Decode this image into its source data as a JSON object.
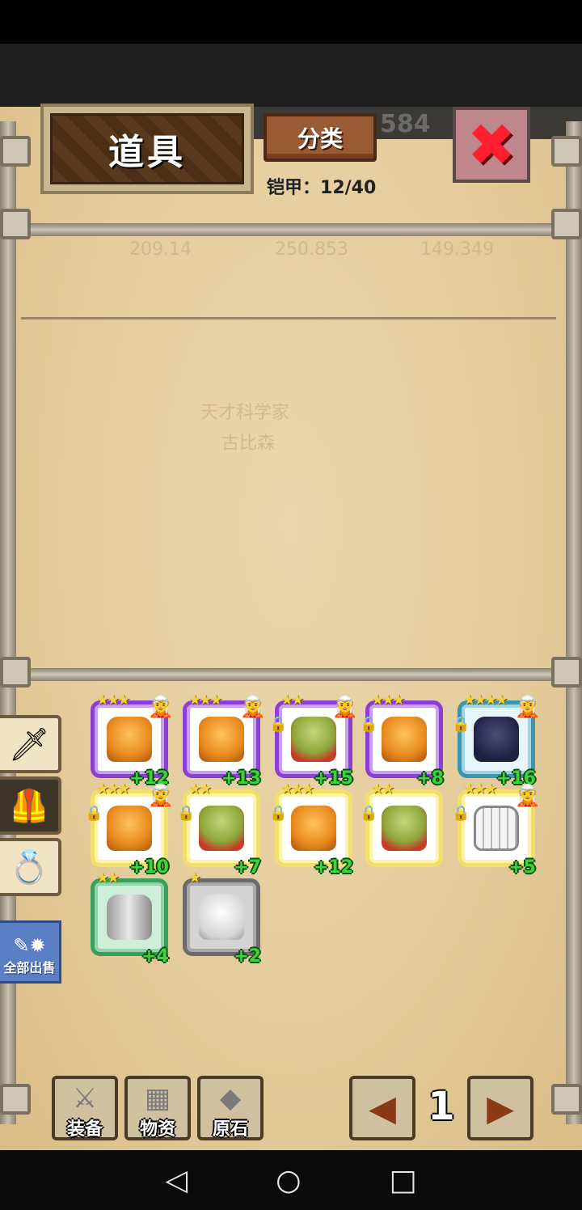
{
  "header": {
    "title": "道具",
    "category_label": "分类",
    "armor_label": "铠甲：",
    "armor_count": "12/40",
    "hud_number": "584"
  },
  "background_ghost_text": [
    "209.14",
    "250.853",
    "149.349",
    "天才科学家",
    "古比森"
  ],
  "side_tabs": [
    {
      "name": "weapon-tab",
      "icon": "sword-icon"
    },
    {
      "name": "armor-tab",
      "icon": "armor-icon",
      "active": true
    },
    {
      "name": "accessory-tab",
      "icon": "ring-icon"
    }
  ],
  "sell_all_label": "全部出售",
  "items": [
    {
      "rarity": "purple",
      "armor": "orange",
      "stars": "★★★",
      "level": "+12",
      "locked": false,
      "hero": true
    },
    {
      "rarity": "purple",
      "armor": "orange",
      "stars": "★★★",
      "level": "+13",
      "locked": false,
      "hero": true
    },
    {
      "rarity": "purple",
      "armor": "olive",
      "stars": "★★",
      "level": "+15",
      "locked": true,
      "hero": true
    },
    {
      "rarity": "purple",
      "armor": "orange",
      "stars": "★★★",
      "level": "+8",
      "locked": true,
      "hero": false
    },
    {
      "rarity": "blue",
      "armor": "navy",
      "stars": "★★★★",
      "level": "+16",
      "locked": true,
      "hero": true
    },
    {
      "rarity": "yellow",
      "armor": "orange",
      "stars": "★★★",
      "level": "+10",
      "locked": true,
      "hero": true
    },
    {
      "rarity": "yellow",
      "armor": "olive",
      "stars": "★★",
      "level": "+7",
      "locked": true,
      "hero": false
    },
    {
      "rarity": "yellow",
      "armor": "orange",
      "stars": "★★★",
      "level": "+12",
      "locked": true,
      "hero": false
    },
    {
      "rarity": "yellow",
      "armor": "olive",
      "stars": "★★",
      "level": "",
      "locked": true,
      "hero": false
    },
    {
      "rarity": "yellow",
      "armor": "white",
      "stars": "★★★",
      "level": "+5",
      "locked": true,
      "hero": true
    },
    {
      "rarity": "green",
      "armor": "silver",
      "stars": "★★",
      "level": "+4",
      "locked": false,
      "hero": false
    },
    {
      "rarity": "gray",
      "armor": "plate",
      "stars": "★",
      "level": "+2",
      "locked": false,
      "hero": false
    }
  ],
  "bottom_bar": {
    "equipment_label": "装备",
    "materials_label": "物资",
    "gem_label": "原石",
    "page": "1"
  },
  "android_nav": {
    "back": "◁",
    "home": "○",
    "recent": "□"
  }
}
